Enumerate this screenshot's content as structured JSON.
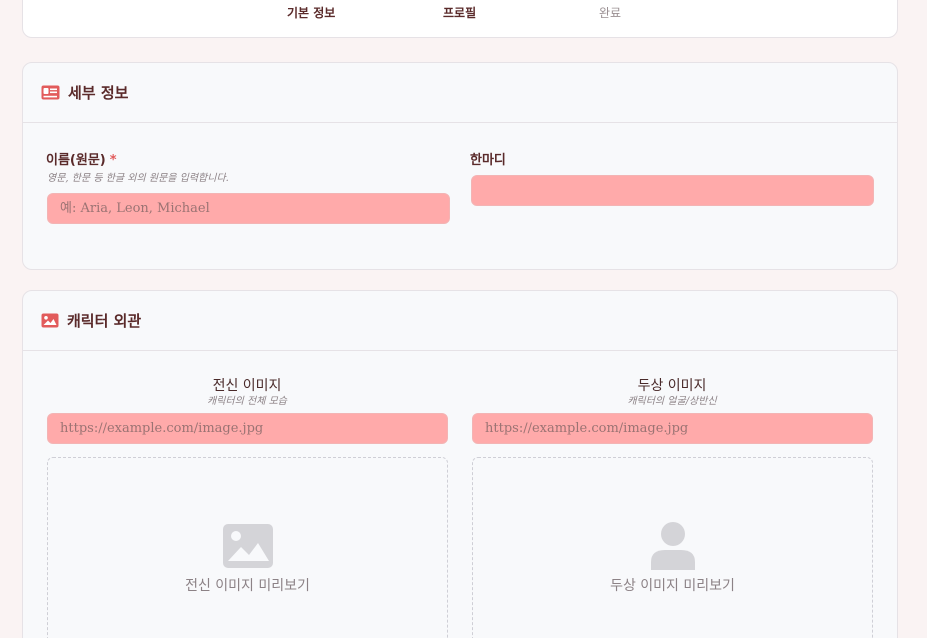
{
  "steps": {
    "items": [
      {
        "label": "기본 정보",
        "state": "done"
      },
      {
        "label": "프로필",
        "state": "active"
      },
      {
        "label": "완료",
        "state": "pending"
      }
    ]
  },
  "detail": {
    "title": "세부 정보",
    "icon": "id-card-icon",
    "name_field": {
      "label": "이름(원문)",
      "required_mark": "*",
      "hint": "영문, 한문 등 한글 외의 원문을 입력합니다.",
      "placeholder": "예: Aria, Leon, Michael",
      "value": ""
    },
    "quote_field": {
      "label": "한마디",
      "placeholder": "",
      "value": ""
    }
  },
  "appearance": {
    "title": "캐릭터 외관",
    "icon": "image-icon",
    "full_body": {
      "label": "전신 이미지",
      "hint": "캐릭터의 전체 모습",
      "placeholder": "https://example.com/image.jpg",
      "preview_text": "전신 이미지 미리보기",
      "preview_icon": "image-placeholder-icon"
    },
    "bust": {
      "label": "두상 이미지",
      "hint": "캐릭터의 얼굴/상반신",
      "placeholder": "https://example.com/image.jpg",
      "preview_text": "두상 이미지 미리보기",
      "preview_icon": "user-placeholder-icon"
    }
  },
  "colors": {
    "accent": "#e25b5b",
    "input_bg": "#ffaaaa",
    "heading": "#5a2a2a"
  }
}
